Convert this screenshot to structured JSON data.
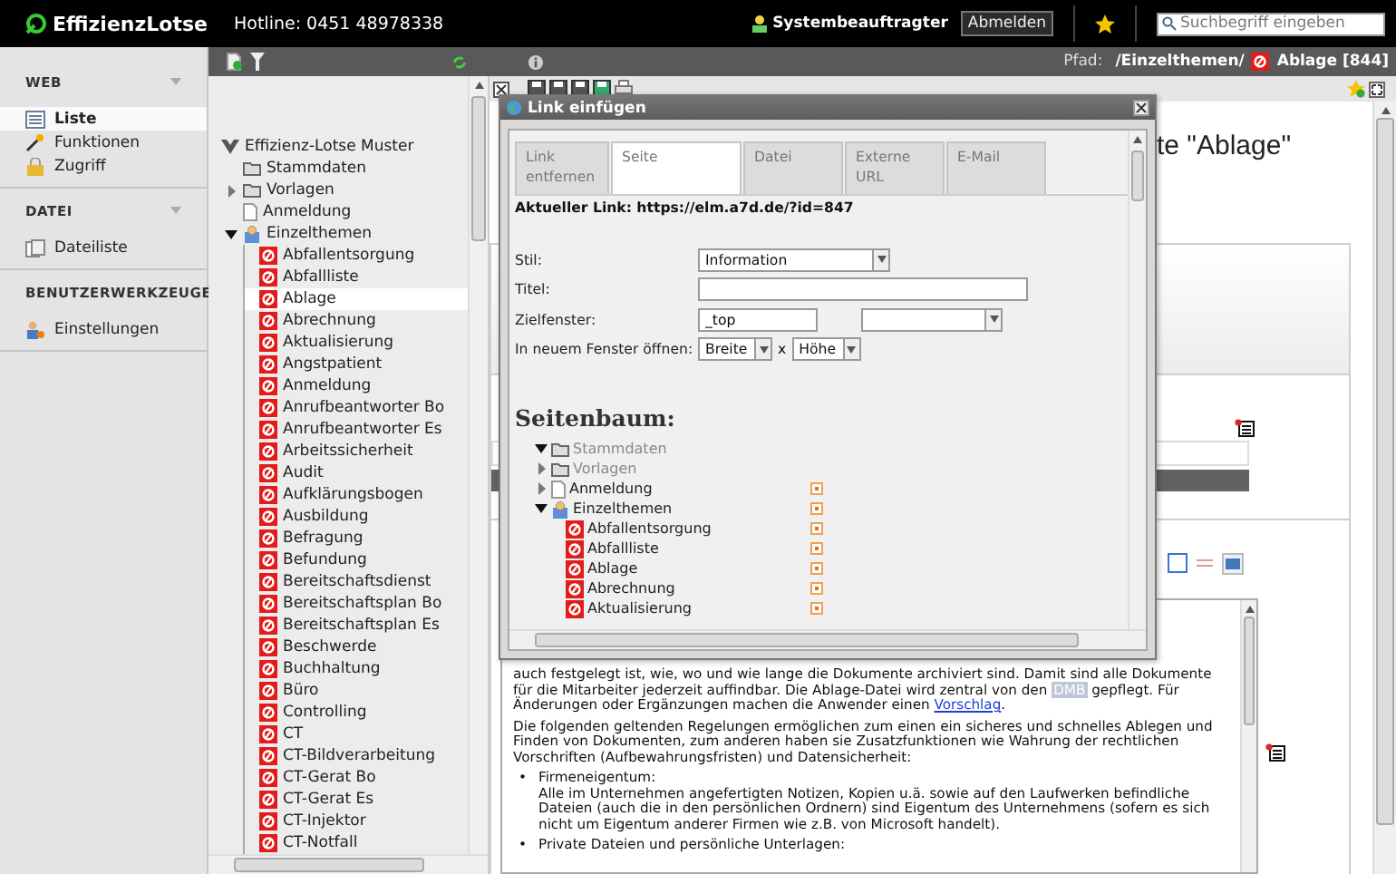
{
  "header": {
    "logo": "EffizienzLotse",
    "hotline": "Hotline: 0451 48978338",
    "user": "Systembeauftragter",
    "logout": "Abmelden",
    "search": {
      "placeholder": "Suchbegriff eingeben"
    }
  },
  "path_bar": {
    "label": "Pfad:",
    "path": "/Einzelthemen/",
    "page": "Ablage [844]"
  },
  "module_menu": [
    {
      "title": "WEB",
      "collapsible": true,
      "items": [
        {
          "label": "Liste",
          "kind": "list",
          "selected": true
        },
        {
          "label": "Funktionen",
          "kind": "wand",
          "selected": false
        },
        {
          "label": "Zugriff",
          "kind": "lock",
          "selected": false
        }
      ]
    },
    {
      "title": "DATEI",
      "collapsible": true,
      "items": [
        {
          "label": "Dateiliste",
          "kind": "files",
          "selected": false
        }
      ]
    },
    {
      "title": "BENUTZERWERKZEUGE",
      "collapsible": false,
      "items": [
        {
          "label": "Einstellungen",
          "kind": "user",
          "selected": false
        }
      ]
    }
  ],
  "page_tree": {
    "root": "Effizienz-Lotse Muster",
    "items": [
      {
        "label": "Stammdaten",
        "kind": "folder",
        "has_children": false
      },
      {
        "label": "Vorlagen",
        "kind": "folder",
        "has_children": true,
        "expanded": false
      },
      {
        "label": "Anmeldung",
        "kind": "page",
        "has_children": false
      },
      {
        "label": "Einzelthemen",
        "kind": "section",
        "has_children": true,
        "expanded": true,
        "children": [
          {
            "label": "Abfallentsorgung",
            "selected": false
          },
          {
            "label": "Abfallliste",
            "selected": false
          },
          {
            "label": "Ablage",
            "selected": true
          },
          {
            "label": "Abrechnung",
            "selected": false
          },
          {
            "label": "Aktualisierung",
            "selected": false
          },
          {
            "label": "Angstpatient",
            "selected": false
          },
          {
            "label": "Anmeldung",
            "selected": false
          },
          {
            "label": "Anrufbeantworter Bo",
            "selected": false
          },
          {
            "label": "Anrufbeantworter Es",
            "selected": false
          },
          {
            "label": "Arbeitssicherheit",
            "selected": false
          },
          {
            "label": "Audit",
            "selected": false
          },
          {
            "label": "Aufklärungsbogen",
            "selected": false
          },
          {
            "label": "Ausbildung",
            "selected": false
          },
          {
            "label": "Befragung",
            "selected": false
          },
          {
            "label": "Befundung",
            "selected": false
          },
          {
            "label": "Bereitschaftsdienst",
            "selected": false
          },
          {
            "label": "Bereitschaftsplan Bo",
            "selected": false
          },
          {
            "label": "Bereitschaftsplan Es",
            "selected": false
          },
          {
            "label": "Beschwerde",
            "selected": false
          },
          {
            "label": "Buchhaltung",
            "selected": false
          },
          {
            "label": "Büro",
            "selected": false
          },
          {
            "label": "Controlling",
            "selected": false
          },
          {
            "label": "CT",
            "selected": false
          },
          {
            "label": "CT-Bildverarbeitung",
            "selected": false
          },
          {
            "label": "CT-Gerat Bo",
            "selected": false
          },
          {
            "label": "CT-Gerat Es",
            "selected": false
          },
          {
            "label": "CT-Injektor",
            "selected": false
          },
          {
            "label": "CT-Notfall",
            "selected": false
          }
        ]
      }
    ]
  },
  "content": {
    "heading": "te \"Ablage\"",
    "editor": {
      "paragraph_1": [
        {
          "kind": "text",
          "text": "auch festgelegt ist, wie, wo und wie lange die Dokumente archiviert sind. Damit sind alle Dokumente für die Mitarbeiter jederzeit auffindbar. Die Ablage-Datei wird zentral von den "
        },
        {
          "kind": "tag",
          "text": "DMB"
        },
        {
          "kind": "text",
          "text": " gepflegt. Für Änderungen oder Ergänzungen machen die Anwender einen "
        },
        {
          "kind": "link",
          "text": "Vorschlag"
        },
        {
          "kind": "text",
          "text": "."
        }
      ],
      "paragraph_2": "Die folgenden geltenden Regelungen ermöglichen zum einen ein sicheres und schnelles Ablegen und Finden von Dokumenten, zum anderen haben sie Zusatzfunktionen wie Wahrung der rechtlichen Vorschriften (Aufbewahrungsfristen) und Datensicherheit:",
      "list": [
        {
          "bullet": "•",
          "title": "Firmeneigentum:",
          "text": "Alle im Unternehmen angefertigten Notizen, Kopien u.ä. sowie auf den Laufwerken befindliche Dateien (auch die in den persönlichen Ordnern) sind Eigentum des Unternehmens (sofern es sich nicht um Eigentum anderer Firmen wie z.B. von Microsoft handelt)."
        },
        {
          "bullet": "•",
          "title": "Private Dateien und persönliche Unterlagen:"
        }
      ]
    }
  },
  "dialog": {
    "title": "Link einfügen",
    "tabs": [
      {
        "label": "Link entfernen",
        "selected": false
      },
      {
        "label": "Seite",
        "selected": true
      },
      {
        "label": "Datei",
        "selected": false
      },
      {
        "label": "Externe URL",
        "selected": false
      },
      {
        "label": "E-Mail",
        "selected": false
      }
    ],
    "current_link": "Aktueller Link: https://elm.a7d.de/?id=847",
    "fields": [
      {
        "label": "Stil:",
        "kind": "select",
        "value": "Information"
      },
      {
        "label": "Titel:",
        "kind": "text"
      },
      {
        "label": "Zielfenster:",
        "kind": "target",
        "value": "_top"
      },
      {
        "label": "In neuem Fenster öffnen:",
        "kind": "size",
        "width": "Breite",
        "separator": "x",
        "height": "Höhe"
      }
    ],
    "tree_title": "Seitenbaum:",
    "tree": [
      {
        "label": "Stammdaten",
        "kind": "folder",
        "has_children": true,
        "expanded": true,
        "disabled": true
      },
      {
        "label": "Vorlagen",
        "kind": "folder",
        "has_children": true,
        "expanded": false,
        "disabled": true
      },
      {
        "label": "Anmeldung",
        "kind": "page",
        "has_children": true,
        "expanded": false,
        "disabled": false
      },
      {
        "label": "Einzelthemen",
        "kind": "section",
        "has_children": true,
        "expanded": true,
        "disabled": false,
        "children": [
          {
            "label": "Abfallentsorgung"
          },
          {
            "label": "Abfallliste"
          },
          {
            "label": "Ablage"
          },
          {
            "label": "Abrechnung"
          },
          {
            "label": "Aktualisierung"
          }
        ]
      }
    ]
  }
}
